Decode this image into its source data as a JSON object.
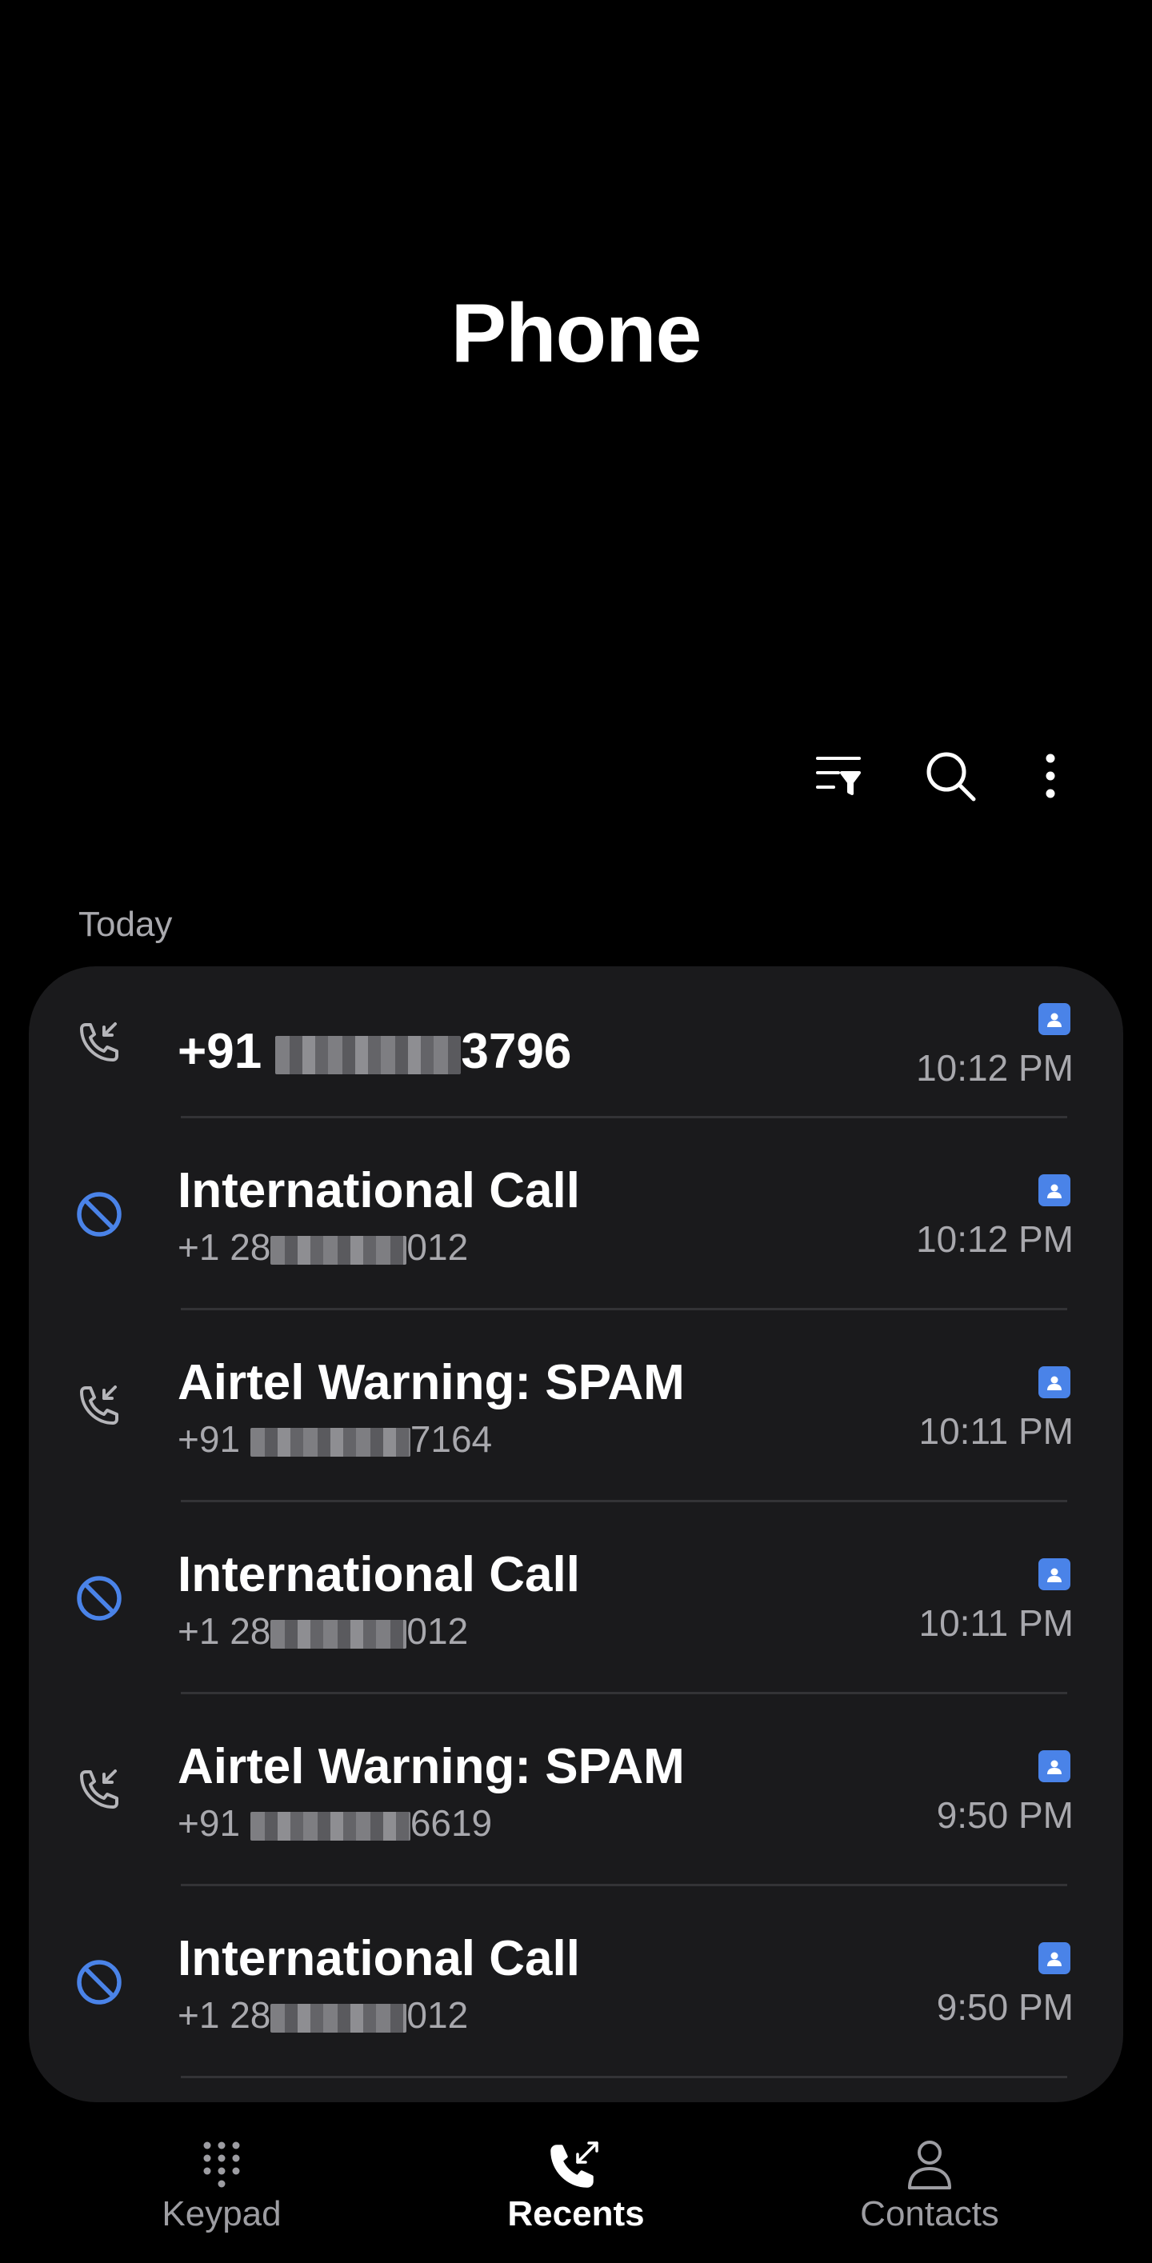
{
  "app": {
    "title": "Phone"
  },
  "toolbar": {
    "filter_icon": "filter-list-icon",
    "search_icon": "search-icon",
    "more_icon": "more-vertical-icon"
  },
  "section": {
    "label": "Today"
  },
  "colors": {
    "accent_blue": "#4a83e8",
    "card_bg": "#1a1a1c",
    "secondary_text": "#a8a8ad"
  },
  "calls": [
    {
      "icon": "incoming-call-icon",
      "title_prefix": "+91 ",
      "title_suffix": "3796",
      "has_subtitle": false,
      "time": "10:12 PM"
    },
    {
      "icon": "blocked-icon",
      "title": "International Call",
      "subtitle_prefix": "+1 28",
      "subtitle_suffix": "012",
      "time": "10:12 PM"
    },
    {
      "icon": "incoming-call-icon",
      "title": "Airtel Warning: SPAM",
      "subtitle_prefix": "+91 ",
      "subtitle_suffix": "7164",
      "time": "10:11 PM"
    },
    {
      "icon": "blocked-icon",
      "title": "International Call",
      "subtitle_prefix": "+1 28",
      "subtitle_suffix": "012",
      "time": "10:11 PM"
    },
    {
      "icon": "incoming-call-icon",
      "title": "Airtel Warning: SPAM",
      "subtitle_prefix": "+91 ",
      "subtitle_suffix": "6619",
      "time": "9:50 PM"
    },
    {
      "icon": "blocked-icon",
      "title": "International Call",
      "subtitle_prefix": "+1 28",
      "subtitle_suffix": "012",
      "time": "9:50 PM"
    }
  ],
  "nav": {
    "items": [
      {
        "label": "Keypad",
        "icon": "keypad-icon",
        "active": false
      },
      {
        "label": "Recents",
        "icon": "recents-icon",
        "active": true
      },
      {
        "label": "Contacts",
        "icon": "contacts-icon",
        "active": false
      }
    ]
  }
}
